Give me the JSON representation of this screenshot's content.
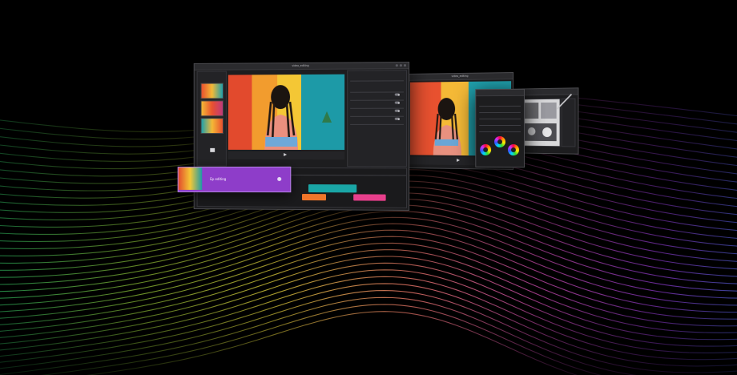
{
  "scene": {
    "windows": {
      "premiere": {
        "title": "video_editing"
      },
      "preview": {
        "title": "video_editing"
      },
      "color_panel": {
        "title": ""
      },
      "photoshop": {
        "title": ""
      }
    },
    "timeline": {
      "clip_purple_label": "Ep editing",
      "clip_orange_label": "",
      "clip_pink_label": ""
    },
    "colors": {
      "background": "#000000",
      "ui_panel": "#1d1d1f",
      "accent_purple": "#8e3dc9",
      "accent_teal": "#1aa6a6",
      "accent_orange": "#f0762a",
      "accent_pink": "#e83f8c"
    },
    "icons": [
      "play-icon",
      "color-wheel-icon",
      "toggle-icon",
      "pen-icon"
    ]
  }
}
